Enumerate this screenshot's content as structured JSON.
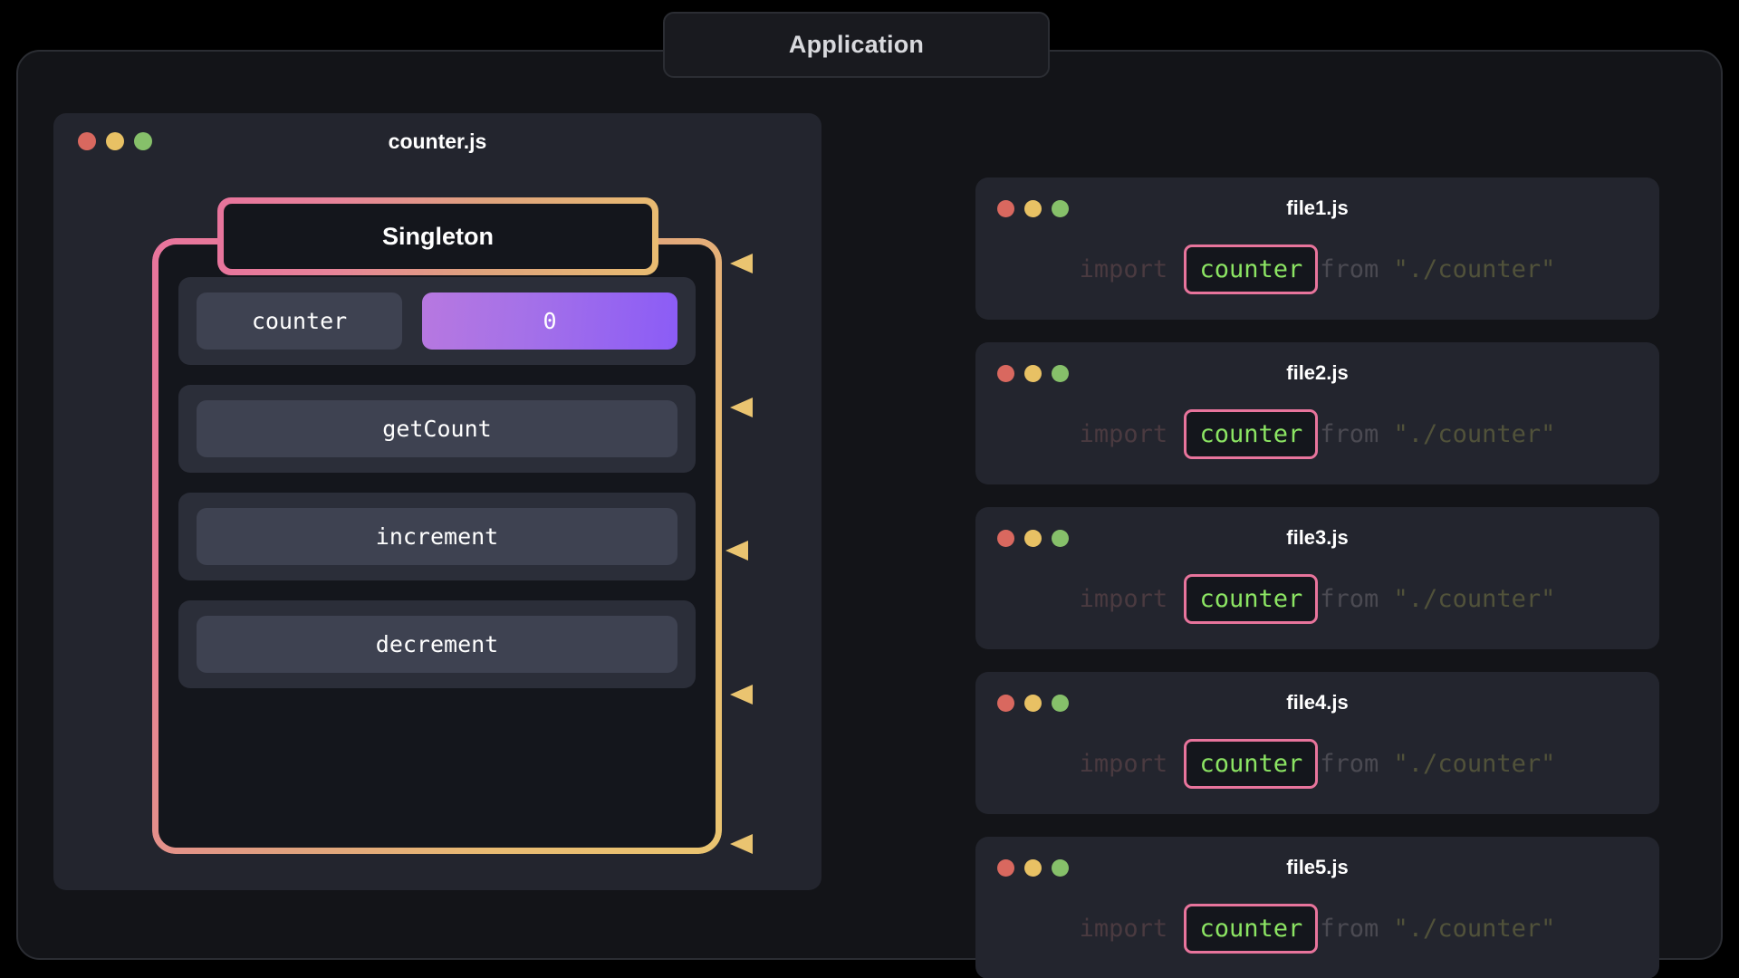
{
  "app": {
    "title": "Application"
  },
  "module_window": {
    "title": "counter.js",
    "traffic_lights": [
      "close-dot-red",
      "minimize-dot-yellow",
      "maximize-dot-green"
    ],
    "singleton": {
      "title": "Singleton",
      "property": {
        "name": "counter",
        "value": "0"
      },
      "methods": [
        {
          "name": "getCount"
        },
        {
          "name": "increment"
        },
        {
          "name": "decrement"
        }
      ]
    }
  },
  "files": [
    {
      "title": "file1.js",
      "code": {
        "keyword": "import",
        "binding": "counter",
        "from": "from",
        "source": "\"./counter\""
      }
    },
    {
      "title": "file2.js",
      "code": {
        "keyword": "import",
        "binding": "counter",
        "from": "from",
        "source": "\"./counter\""
      }
    },
    {
      "title": "file3.js",
      "code": {
        "keyword": "import",
        "binding": "counter",
        "from": "from",
        "source": "\"./counter\""
      }
    },
    {
      "title": "file4.js",
      "code": {
        "keyword": "import",
        "binding": "counter",
        "from": "from",
        "source": "\"./counter\""
      }
    },
    {
      "title": "file5.js",
      "code": {
        "keyword": "import",
        "binding": "counter",
        "from": "from",
        "source": "\"./counter\""
      }
    }
  ],
  "colors": {
    "background": "#000000",
    "frame": "#131418",
    "window": "#23252e",
    "panel_dark": "#14161c",
    "row": "#2b2e39",
    "chip": "#3e4251",
    "accent_pink": "#e8749c",
    "accent_gold": "#eac470",
    "value_gradient_start": "#b778e0",
    "value_gradient_end": "#8b5cf6",
    "binding_text": "#8ce563",
    "dot_red": "#d9685f",
    "dot_yellow": "#e8c164",
    "dot_green": "#86c06a"
  }
}
